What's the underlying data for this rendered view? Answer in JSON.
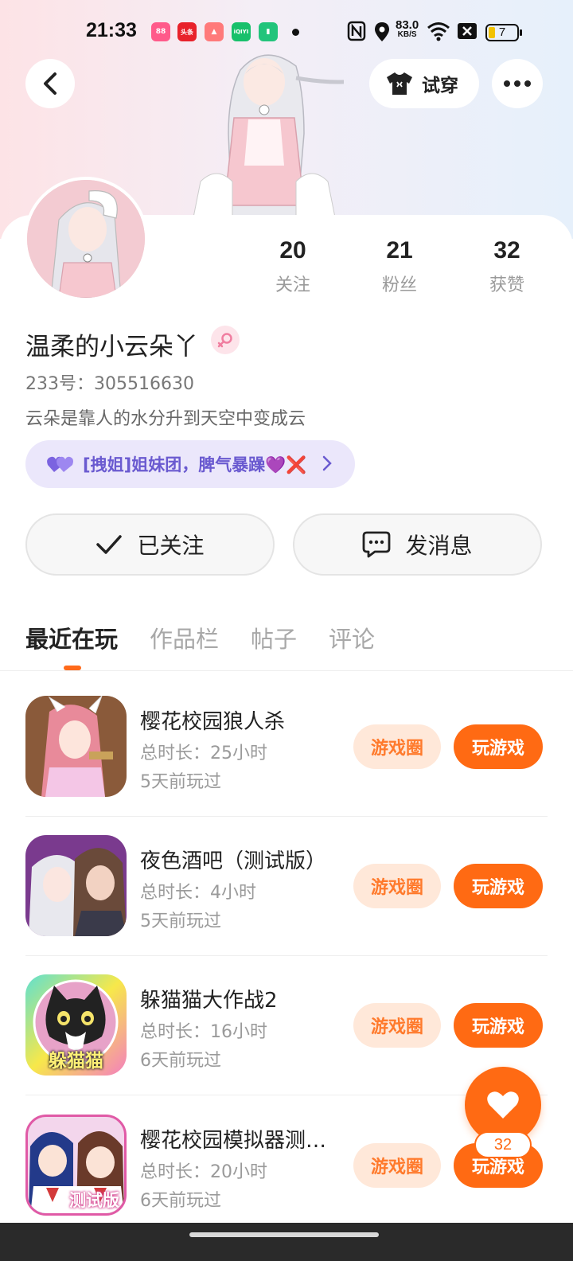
{
  "status_bar": {
    "time": "21:33",
    "net_speed_value": "83.0",
    "net_speed_unit": "KB/S",
    "battery": "7",
    "app_icons": [
      {
        "name": "app-icon-1",
        "color": "#ff5a8a",
        "text": "88"
      },
      {
        "name": "app-icon-2",
        "color": "#e8222b",
        "text": "头条"
      },
      {
        "name": "app-icon-3",
        "color": "#ff6a6a",
        "text": "🎮"
      },
      {
        "name": "app-icon-4",
        "color": "#18c06b",
        "text": "iQIYI"
      },
      {
        "name": "app-icon-5",
        "color": "#22c47b",
        "text": "▯"
      }
    ]
  },
  "header": {
    "try_on_label": "试穿"
  },
  "profile": {
    "stats": [
      {
        "value": "20",
        "label": "关注"
      },
      {
        "value": "21",
        "label": "粉丝"
      },
      {
        "value": "32",
        "label": "获赞"
      }
    ],
    "nickname": "温柔的小云朵丫",
    "uid": "233号：305516630",
    "bio": "云朵是靠人的水分升到天空中变成云",
    "group_tag": "[拽姐]姐妹团，脾气暴躁💜❌"
  },
  "actions": {
    "follow_label": "已关注",
    "message_label": "发消息"
  },
  "tabs": [
    {
      "label": "最近在玩",
      "active": true
    },
    {
      "label": "作品栏",
      "active": false
    },
    {
      "label": "帖子",
      "active": false
    },
    {
      "label": "评论",
      "active": false
    }
  ],
  "games": [
    {
      "name": "樱花校园狼人杀",
      "duration": "总时长：25小时",
      "last_played": "5天前玩过",
      "circle_label": "游戏圈",
      "play_label": "玩游戏"
    },
    {
      "name": "夜色酒吧（测试版）",
      "duration": "总时长：4小时",
      "last_played": "5天前玩过",
      "circle_label": "游戏圈",
      "play_label": "玩游戏"
    },
    {
      "name": "躲猫猫大作战2",
      "duration": "总时长：16小时",
      "last_played": "6天前玩过",
      "circle_label": "游戏圈",
      "play_label": "玩游戏",
      "icon_text": "躲猫猫"
    },
    {
      "name": "樱花校园模拟器测…",
      "duration": "总时长：20小时",
      "last_played": "6天前玩过",
      "circle_label": "游戏圈",
      "play_label": "玩游戏",
      "icon_text": "测试版"
    }
  ],
  "like_fab": {
    "count": "32"
  },
  "colors": {
    "accent": "#ff6a13",
    "accent_soft": "#ffe8d9",
    "tag_bg": "#ebe7fb",
    "tag_text": "#6a5ad0"
  }
}
